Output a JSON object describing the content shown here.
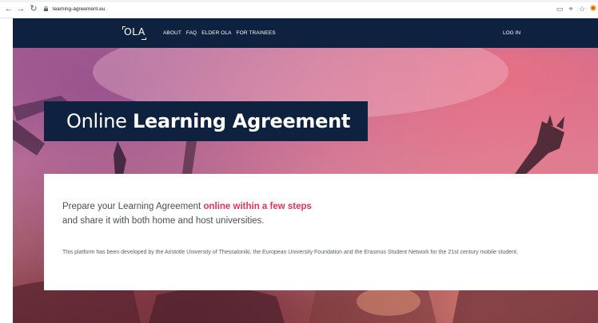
{
  "browser": {
    "url": "learning-agreement.eu",
    "icons": {
      "back": "arrow-left-icon",
      "forward": "arrow-right-icon",
      "reload": "reload-icon",
      "lock": "lock-icon",
      "extensions": [
        "screen-icon",
        "grid-icon",
        "star-icon",
        "profile-icon"
      ]
    }
  },
  "header": {
    "logo": "OLA",
    "nav": [
      "ABOUT",
      "FAQ",
      "ELDER OLA",
      "FOR TRAINEES"
    ],
    "login": "LOG IN"
  },
  "hero": {
    "title_light": "Online ",
    "title_bold": "Learning Agreement"
  },
  "card": {
    "tagline_part1": "Prepare your Learning Agreement ",
    "tagline_highlight": "online within a few steps",
    "tagline_line2": "and share it with both home and host universities.",
    "description": "This platform has been developed by the Aristotle University of Thessaloniki, the European University Foundation and the Erasmus Student Network for the 21st century mobile student."
  },
  "colors": {
    "navy": "#0e2240",
    "accent_red": "#e4335c",
    "text_gray": "#4a4f57"
  }
}
